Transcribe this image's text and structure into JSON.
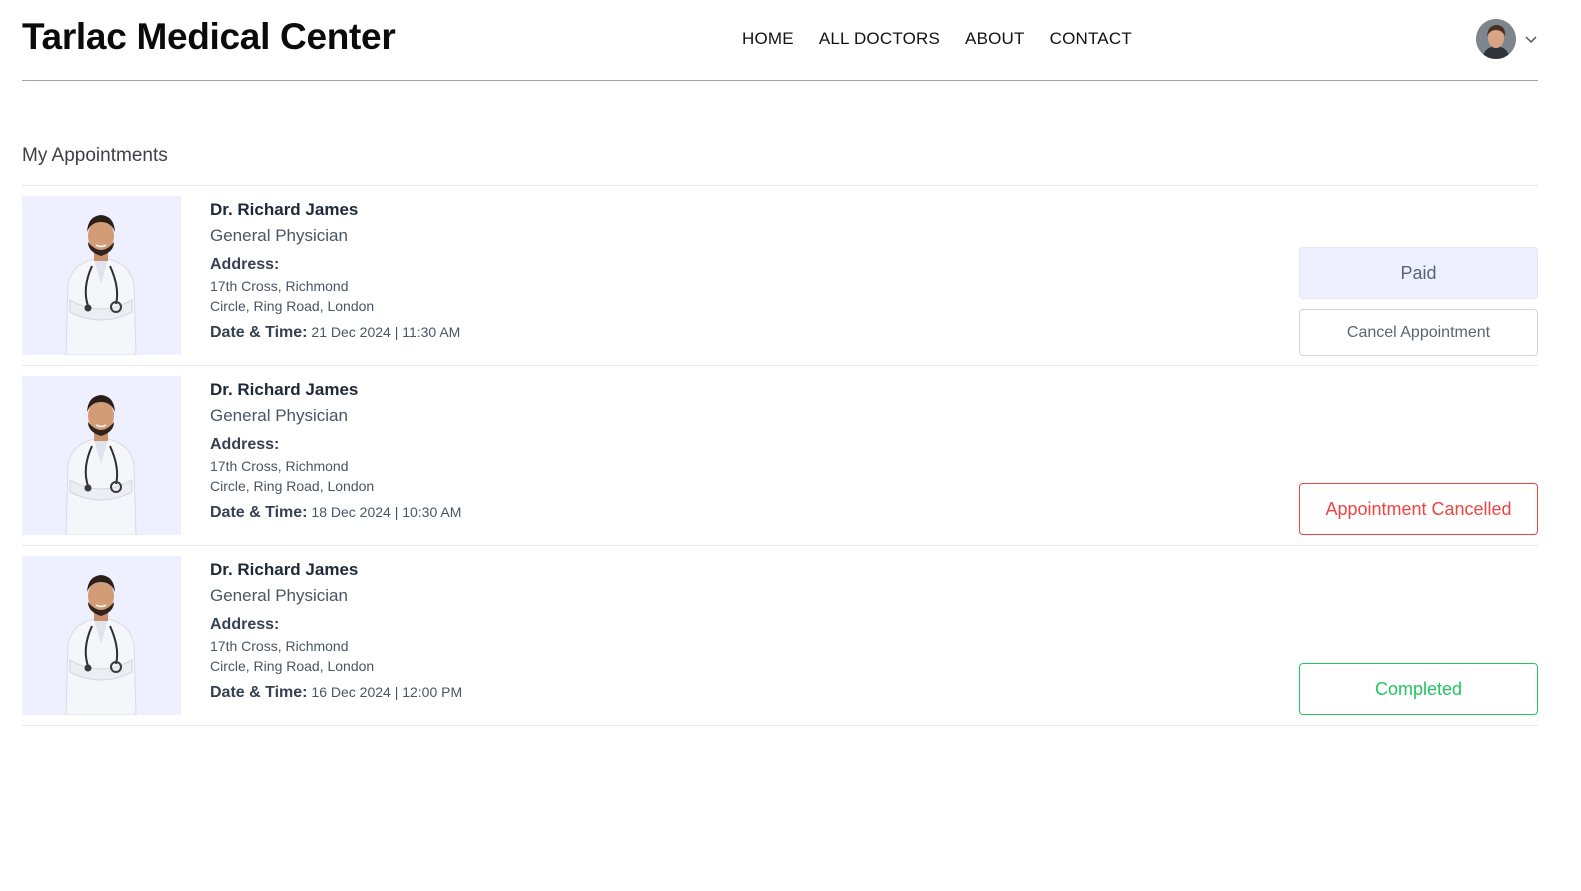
{
  "header": {
    "brand": "Tarlac Medical Center",
    "nav": [
      "HOME",
      "ALL DOCTORS",
      "ABOUT",
      "CONTACT"
    ],
    "profile_icon": "user-avatar",
    "dropdown_icon": "chevron-down-icon"
  },
  "main": {
    "title": "My Appointments",
    "appointments": [
      {
        "doctor": "Dr. Richard James",
        "speciality": "General Physician",
        "address_label": "Address:",
        "address_line1": "17th Cross, Richmond",
        "address_line2": "Circle, Ring Road, London",
        "datetime_label": "Date & Time:",
        "datetime": "21 Dec 2024 | 11:30 AM",
        "paid_label": "Paid",
        "cancel_label": "Cancel Appointment"
      },
      {
        "doctor": "Dr. Richard James",
        "speciality": "General Physician",
        "address_label": "Address:",
        "address_line1": "17th Cross, Richmond",
        "address_line2": "Circle, Ring Road, London",
        "datetime_label": "Date & Time:",
        "datetime": "18 Dec 2024 | 10:30 AM",
        "status_label": "Appointment Cancelled"
      },
      {
        "doctor": "Dr. Richard James",
        "speciality": "General Physician",
        "address_label": "Address:",
        "address_line1": "17th Cross, Richmond",
        "address_line2": "Circle, Ring Road, London",
        "datetime_label": "Date & Time:",
        "datetime": "16 Dec 2024 | 12:00 PM",
        "status_label": "Completed"
      }
    ]
  },
  "colors": {
    "photo_bg": "#eef0ff",
    "cancelled": "#ef4444",
    "completed": "#22c55e",
    "paid_bg": "#eef0ff"
  }
}
